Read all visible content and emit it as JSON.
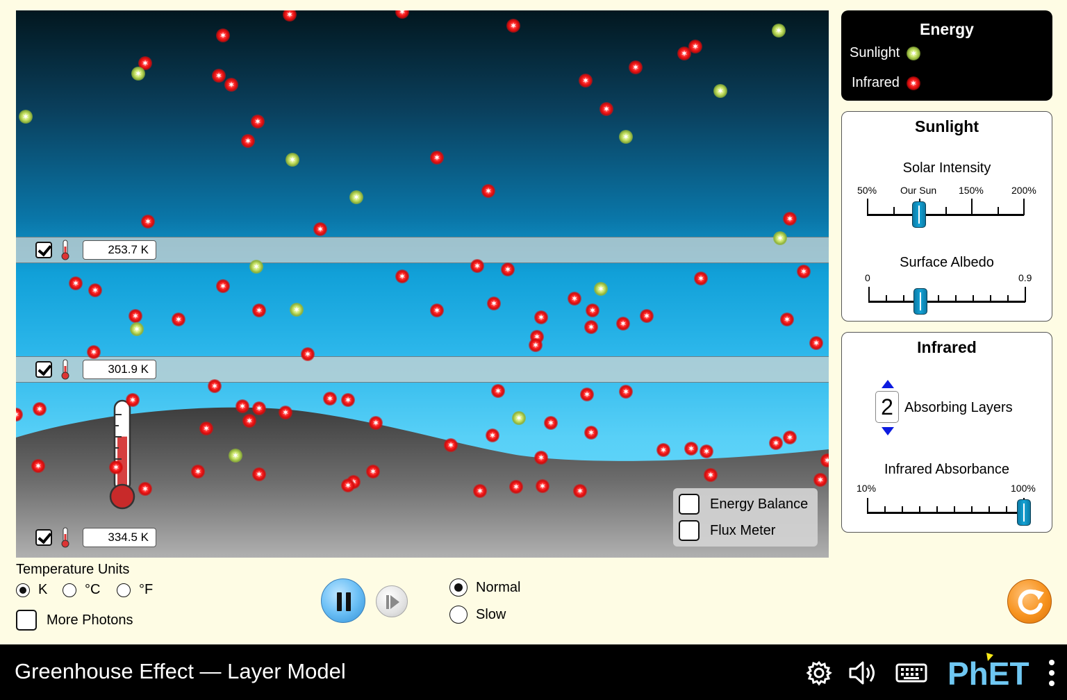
{
  "colors": {
    "background": "#FEFCE4",
    "accent_blue": "#0C7BA6",
    "reset_orange": "#F7931E",
    "phet_blue": "#6FC7F2",
    "phet_yellow": "#F9EA18"
  },
  "layers": [
    {
      "temperature": "253.7 K",
      "checked": true
    },
    {
      "temperature": "301.9 K",
      "checked": true
    }
  ],
  "surface": {
    "temperature": "334.5 K",
    "checked": true
  },
  "surface_thermometer_fill_fraction": 0.62,
  "sim_options": {
    "energy_balance": {
      "label": "Energy Balance",
      "checked": false
    },
    "flux_meter": {
      "label": "Flux Meter",
      "checked": false
    }
  },
  "energy_legend": {
    "title": "Energy",
    "sunlight": "Sunlight",
    "infrared": "Infrared",
    "sunlight_icon": "sunlight-photon-icon",
    "infrared_icon": "infrared-photon-icon"
  },
  "sunlight_panel": {
    "title": "Sunlight",
    "solar_intensity": {
      "label": "Solar Intensity",
      "ticks": [
        "50%",
        "Our Sun",
        "150%",
        "200%"
      ],
      "value_percent": 100
    },
    "surface_albedo": {
      "label": "Surface Albedo",
      "min": "0",
      "max": "0.9",
      "value": 0.3
    }
  },
  "infrared_panel": {
    "title": "Infrared",
    "absorbing_layers": {
      "value": "2",
      "label": "Absorbing Layers"
    },
    "infrared_absorbance": {
      "label": "Infrared Absorbance",
      "min": "10%",
      "max": "100%",
      "value_percent": 100
    }
  },
  "temperature_units": {
    "label": "Temperature Units",
    "options": [
      "K",
      "°C",
      "°F"
    ],
    "selected": "K"
  },
  "more_photons": {
    "label": "More Photons",
    "checked": false
  },
  "time_controls": {
    "playing": true
  },
  "speed": {
    "options": [
      "Normal",
      "Slow"
    ],
    "selected": "Normal"
  },
  "navbar": {
    "title": "Greenhouse Effect — Layer Model",
    "icons": [
      "settings-gear-icon",
      "sound-speaker-icon",
      "keyboard-icon",
      "phet-logo",
      "kebab-menu-icon"
    ],
    "logo_text": "PhET"
  }
}
